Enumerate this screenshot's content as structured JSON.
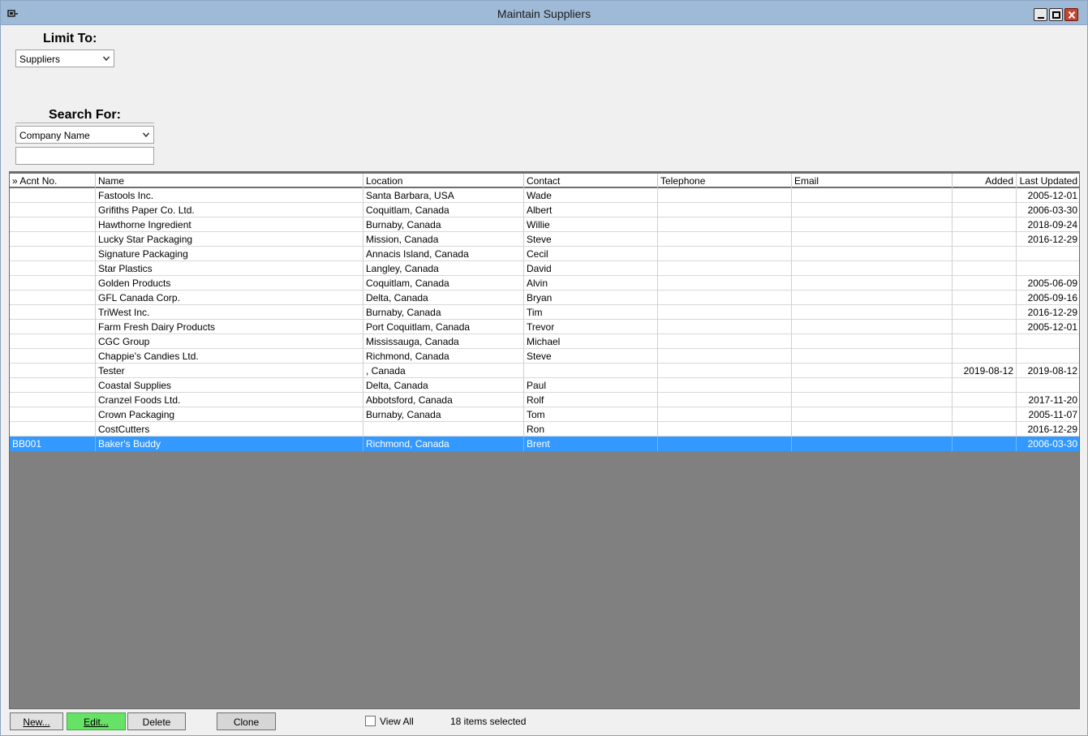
{
  "window": {
    "title": "Maintain Suppliers"
  },
  "filters": {
    "limit_to_label": "Limit To:",
    "limit_to_value": "Suppliers",
    "search_for_label": "Search For:",
    "search_field_value": "Company Name",
    "search_text": ""
  },
  "table": {
    "columns": [
      "» Acnt No.",
      "Name",
      "Location",
      "Contact",
      "Telephone",
      "Email",
      "Added",
      "Last Updated"
    ],
    "rows": [
      [
        "",
        "Fastools Inc.",
        "Santa Barbara, USA",
        "Wade",
        "",
        "",
        "",
        "2005-12-01"
      ],
      [
        "",
        "Grifiths Paper Co. Ltd.",
        "Coquitlam, Canada",
        "Albert",
        "",
        "",
        "",
        "2006-03-30"
      ],
      [
        "",
        "Hawthorne Ingredient",
        "Burnaby, Canada",
        "Willie",
        "",
        "",
        "",
        "2018-09-24"
      ],
      [
        "",
        "Lucky Star Packaging",
        "Mission, Canada",
        "Steve",
        "",
        "",
        "",
        "2016-12-29"
      ],
      [
        "",
        "Signature Packaging",
        "Annacis Island, Canada",
        "Cecil",
        "",
        "",
        "",
        ""
      ],
      [
        "",
        "Star Plastics",
        "Langley, Canada",
        "David",
        "",
        "",
        "",
        ""
      ],
      [
        "",
        "Golden Products",
        "Coquitlam, Canada",
        "Alvin",
        "",
        "",
        "",
        "2005-06-09"
      ],
      [
        "",
        "GFL Canada Corp.",
        "Delta, Canada",
        "Bryan",
        "",
        "",
        "",
        "2005-09-16"
      ],
      [
        "",
        "TriWest Inc.",
        "Burnaby, Canada",
        "Tim",
        "",
        "",
        "",
        "2016-12-29"
      ],
      [
        "",
        "Farm Fresh Dairy Products",
        "Port Coquitlam, Canada",
        "Trevor",
        "",
        "",
        "",
        "2005-12-01"
      ],
      [
        "",
        "CGC Group",
        "Mississauga, Canada",
        "Michael",
        "",
        "",
        "",
        ""
      ],
      [
        "",
        "Chappie's Candies Ltd.",
        "Richmond, Canada",
        "Steve",
        "",
        "",
        "",
        ""
      ],
      [
        "",
        "Tester",
        ", Canada",
        "",
        "",
        "",
        "2019-08-12",
        "2019-08-12"
      ],
      [
        "",
        "Coastal Supplies",
        "Delta, Canada",
        "Paul",
        "",
        "",
        "",
        ""
      ],
      [
        "",
        "Cranzel Foods Ltd.",
        "Abbotsford, Canada",
        "Rolf",
        "",
        "",
        "",
        "2017-11-20"
      ],
      [
        "",
        "Crown Packaging",
        "Burnaby, Canada",
        "Tom",
        "",
        "",
        "",
        "2005-11-07"
      ],
      [
        "",
        "CostCutters",
        "",
        "Ron",
        "",
        "",
        "",
        "2016-12-29"
      ],
      [
        "BB001",
        "Baker's Buddy",
        "Richmond, Canada",
        "Brent",
        "",
        "",
        "",
        "2006-03-30"
      ]
    ],
    "selected_row_index": 17
  },
  "footer": {
    "new_label": "New...",
    "edit_label": "Edit...",
    "delete_label": "Delete",
    "clone_label": "Clone",
    "view_all_label": "View All",
    "status_text": "18 items selected"
  },
  "colors": {
    "titlebar": "#9fbad6",
    "selection": "#3399ff",
    "edit_button": "#66e266",
    "grid_background": "#808080"
  }
}
